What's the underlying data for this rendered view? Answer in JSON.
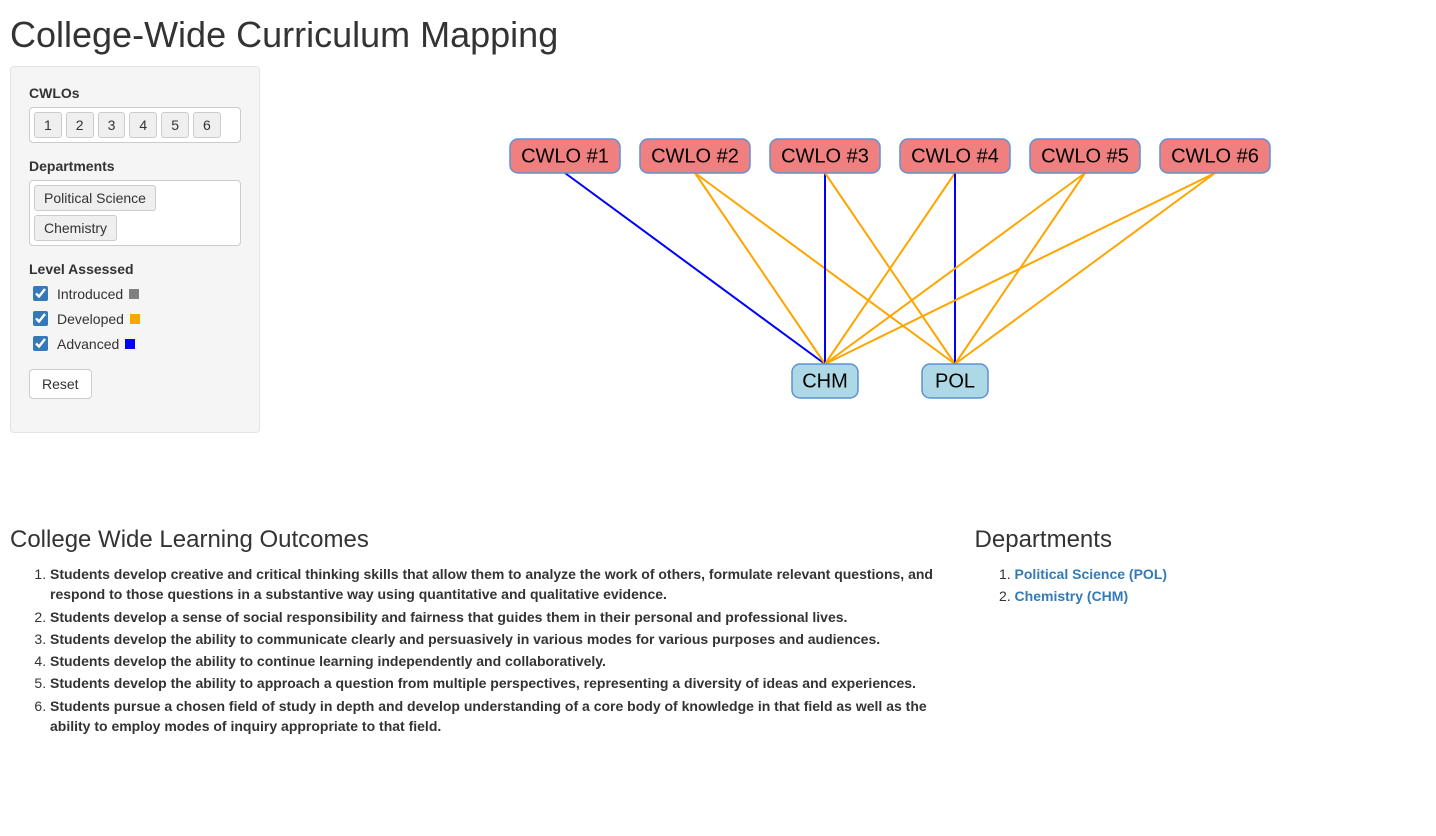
{
  "title": "College-Wide Curriculum Mapping",
  "sidebar": {
    "cwlos_label": "CWLOs",
    "cwlo_buttons": [
      "1",
      "2",
      "3",
      "4",
      "5",
      "6"
    ],
    "departments_label": "Departments",
    "dept_buttons": [
      "Political Science",
      "Chemistry"
    ],
    "level_label": "Level Assessed",
    "levels": [
      {
        "label": "Introduced",
        "color": "#808080",
        "checked": true
      },
      {
        "label": "Developed",
        "color": "#ffa500",
        "checked": true
      },
      {
        "label": "Advanced",
        "color": "#0000ff",
        "checked": true
      }
    ],
    "reset_label": "Reset"
  },
  "chart_data": {
    "type": "network",
    "top_nodes": [
      {
        "id": "CWLO1",
        "label": "CWLO #1"
      },
      {
        "id": "CWLO2",
        "label": "CWLO #2"
      },
      {
        "id": "CWLO3",
        "label": "CWLO #3"
      },
      {
        "id": "CWLO4",
        "label": "CWLO #4"
      },
      {
        "id": "CWLO5",
        "label": "CWLO #5"
      },
      {
        "id": "CWLO6",
        "label": "CWLO #6"
      }
    ],
    "bottom_nodes": [
      {
        "id": "CHM",
        "label": "CHM"
      },
      {
        "id": "POL",
        "label": "POL"
      }
    ],
    "edges": [
      {
        "from": "CWLO1",
        "to": "CHM",
        "level": "Advanced"
      },
      {
        "from": "CWLO2",
        "to": "CHM",
        "level": "Developed"
      },
      {
        "from": "CWLO2",
        "to": "POL",
        "level": "Developed"
      },
      {
        "from": "CWLO3",
        "to": "CHM",
        "level": "Advanced"
      },
      {
        "from": "CWLO3",
        "to": "POL",
        "level": "Developed"
      },
      {
        "from": "CWLO4",
        "to": "CHM",
        "level": "Developed"
      },
      {
        "from": "CWLO4",
        "to": "POL",
        "level": "Advanced"
      },
      {
        "from": "CWLO5",
        "to": "CHM",
        "level": "Developed"
      },
      {
        "from": "CWLO5",
        "to": "POL",
        "level": "Developed"
      },
      {
        "from": "CWLO6",
        "to": "CHM",
        "level": "Developed"
      },
      {
        "from": "CWLO6",
        "to": "POL",
        "level": "Developed"
      }
    ],
    "level_colors": {
      "Introduced": "#808080",
      "Developed": "#ffa500",
      "Advanced": "#0000ff"
    }
  },
  "outcomes": {
    "heading": "College Wide Learning Outcomes",
    "items": [
      "Students develop creative and critical thinking skills that allow them to analyze the work of others, formulate relevant questions, and respond to those questions in a substantive way using quantitative and qualitative evidence.",
      "Students develop a sense of social responsibility and fairness that guides them in their personal and professional lives.",
      "Students develop the ability to communicate clearly and persuasively in various modes for various purposes and audiences.",
      "Students develop the ability to continue learning independently and collaboratively.",
      "Students develop the ability to approach a question from multiple perspectives, representing a diversity of ideas and experiences.",
      "Students pursue a chosen field of study in depth and develop understanding of a core body of knowledge in that field as well as the ability to employ modes of inquiry appropriate to that field."
    ]
  },
  "departments": {
    "heading": "Departments",
    "items": [
      "Political Science (POL)",
      "Chemistry (CHM)"
    ]
  }
}
